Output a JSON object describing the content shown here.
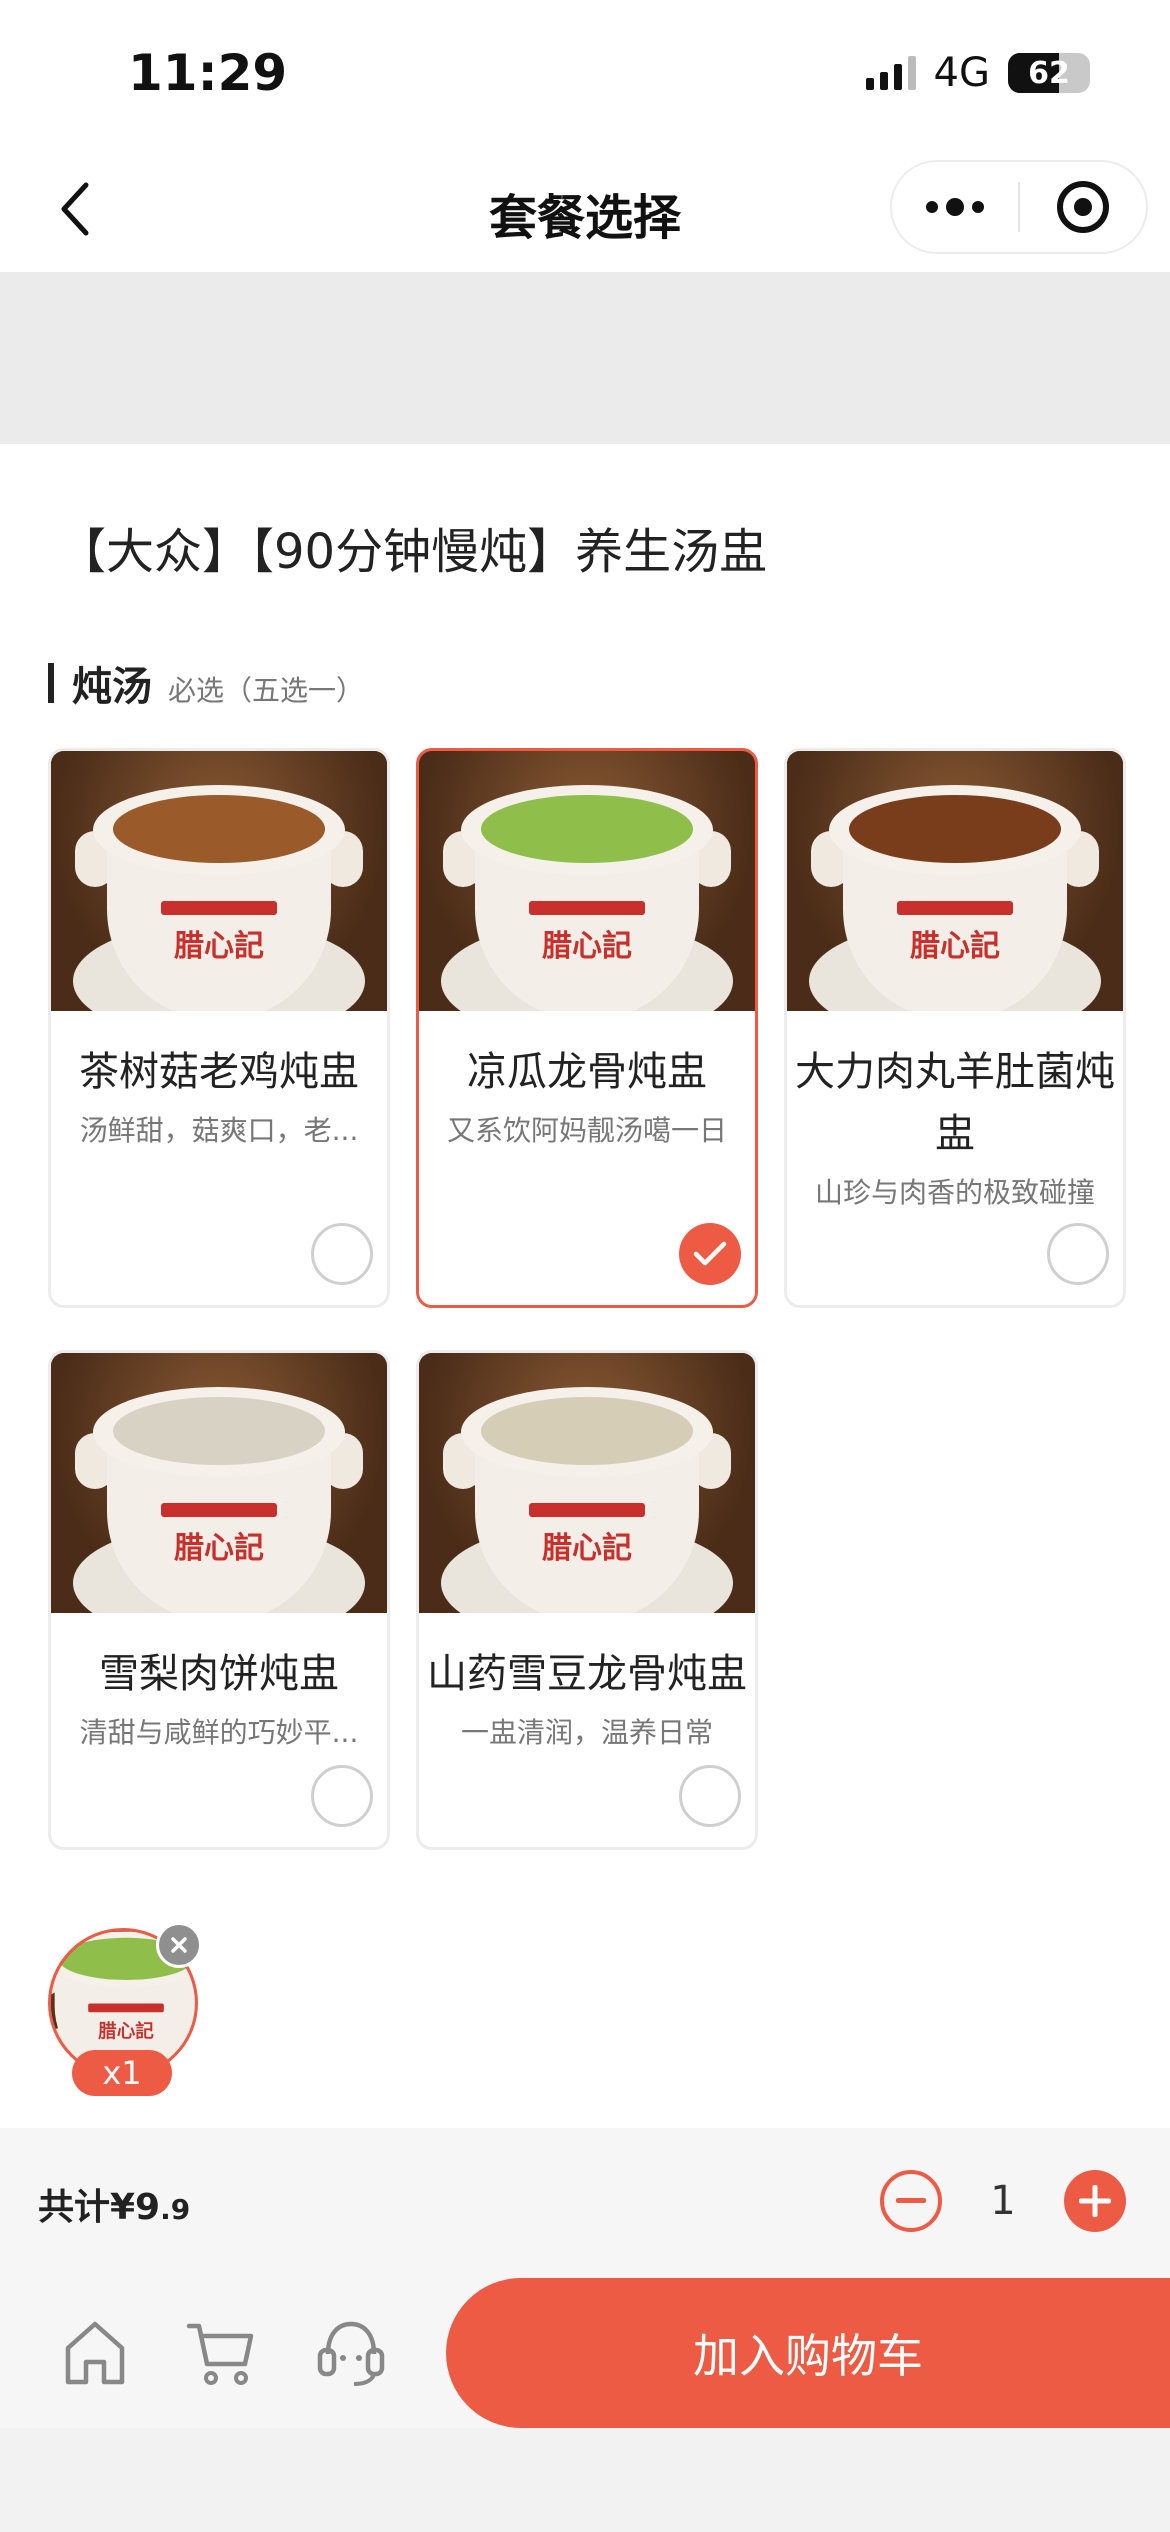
{
  "status": {
    "time": "11:29",
    "network": "4G",
    "battery": "62",
    "battery_level": 0.62
  },
  "nav": {
    "title": "套餐选择",
    "back_icon": "chevron-left-icon",
    "more_icon": "more-dots-icon",
    "close_icon": "target-icon"
  },
  "product": {
    "title": "【大众】【90分钟慢炖】养生汤盅"
  },
  "section": {
    "title": "炖汤",
    "note": "必选（五选一）"
  },
  "items": [
    {
      "name": "茶树菇老鸡炖盅",
      "desc": "汤鲜甜，菇爽口，老...",
      "selected": false,
      "soup": "#9a5a2a",
      "pot_logo": "腊心記"
    },
    {
      "name": "凉瓜龙骨炖盅",
      "desc": "又系饮阿妈靓汤噶一日",
      "selected": true,
      "soup": "#8fbf4a",
      "pot_logo": "腊心記"
    },
    {
      "name": "大力肉丸羊肚菌炖盅",
      "desc": "山珍与肉香的极致碰撞",
      "selected": false,
      "soup": "#7a3d1c",
      "pot_logo": "腊心記"
    },
    {
      "name": "雪梨肉饼炖盅",
      "desc": "清甜与咸鲜的巧妙平...",
      "selected": false,
      "soup": "#d8d2c4",
      "pot_logo": "腊心記"
    },
    {
      "name": "山药雪豆龙骨炖盅",
      "desc": "一盅清润，温养日常",
      "selected": false,
      "soup": "#d6cdb6",
      "pot_logo": "腊心記"
    }
  ],
  "selection": {
    "qty_label": "x1"
  },
  "total": {
    "label": "共计¥9",
    "cents": ".9"
  },
  "stepper": {
    "value": "1"
  },
  "footer": {
    "cta": "加入购物车",
    "icons": [
      "home-icon",
      "cart-icon",
      "customer-service-icon"
    ]
  },
  "colors": {
    "accent": "#ee5b45"
  }
}
